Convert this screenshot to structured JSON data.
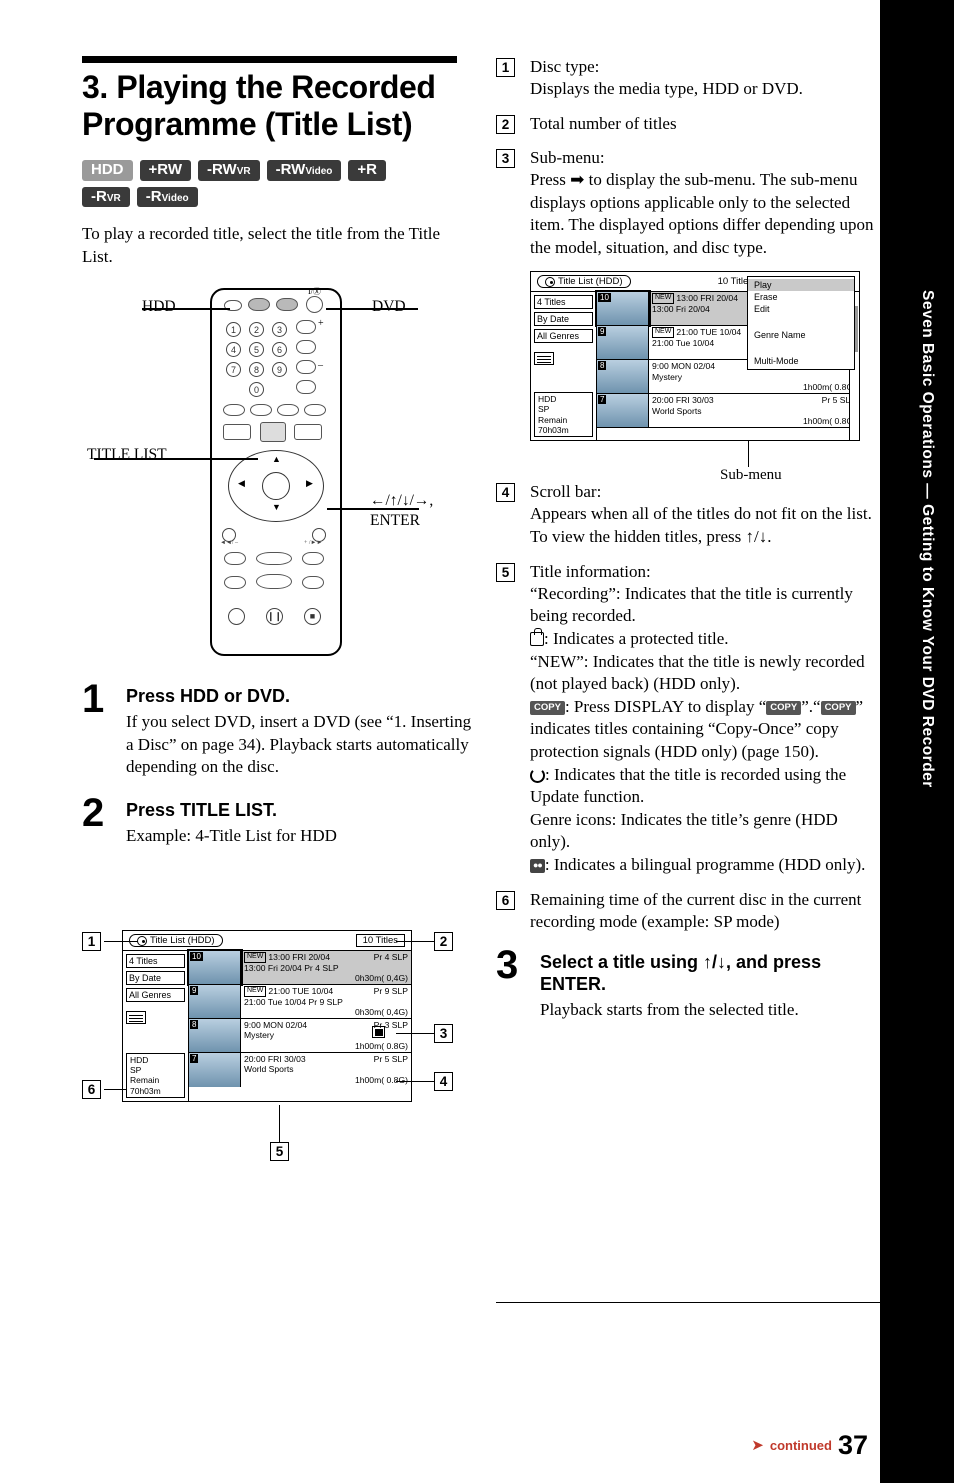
{
  "page": {
    "number": "37",
    "continued": "continued",
    "side_tab": "Seven Basic Operations — Getting to Know Your DVD Recorder"
  },
  "heading": "3. Playing the Recorded Programme (Title List)",
  "badges": [
    {
      "label": "HDD",
      "sub": "",
      "style": "gray"
    },
    {
      "label": "+RW",
      "sub": "",
      "style": "dark"
    },
    {
      "label": "-RW",
      "sub": "VR",
      "style": "dark"
    },
    {
      "label": "-RW",
      "sub": "Video",
      "style": "dark"
    },
    {
      "label": "+R",
      "sub": "",
      "style": "dark"
    },
    {
      "label": "-R",
      "sub": "VR",
      "style": "dark"
    },
    {
      "label": "-R",
      "sub": "Video",
      "style": "dark"
    }
  ],
  "intro": "To play a recorded title, select the title from the Title List.",
  "remote": {
    "label_hdd": "HDD",
    "label_dvd": "DVD",
    "label_title_list": "TITLE LIST",
    "label_enter": "ENTER",
    "label_arrows": "←/↑/↓/→,"
  },
  "steps": [
    {
      "num": "1",
      "title": "Press HDD or DVD.",
      "body": "If you select DVD, insert a DVD (see “1. Inserting a Disc” on page 34). Playback starts automatically depending on the disc."
    },
    {
      "num": "2",
      "title": "Press TITLE LIST.",
      "body": "Example: 4-Title List for HDD"
    },
    {
      "num": "3",
      "title": "Select a title using ↑/↓, and press ENTER.",
      "body": "Playback starts from the selected title."
    }
  ],
  "screen": {
    "tab_label": "Title List (HDD)",
    "titles_count": "10 Titles",
    "left_panel": [
      "4 Titles",
      "By Date",
      "All Genres"
    ],
    "remain": [
      "HDD",
      "SP",
      "Remain",
      "70h03m"
    ],
    "rows": [
      {
        "num": "10",
        "new": "NEW",
        "line1": "13:00 FRI 20/04",
        "line2": "13:00  Fri 20/04",
        "mode": "Pr 4 SLP",
        "mode2": "Pr 4 SLP",
        "size": "0h30m( 0,4G)",
        "selected": true
      },
      {
        "num": "9",
        "new": "NEW",
        "line1": "21:00 TUE 10/04",
        "line2": "21:00  Tue 10/04",
        "mode": "Pr 9 SLP",
        "mode2": "Pr 9 SLP",
        "size": "0h30m( 0,4G)",
        "selected": false
      },
      {
        "num": "8",
        "new": "",
        "line1": "9:00 MON 02/04",
        "line2": "Mystery",
        "mode": "Pr 3 SLP",
        "mode2": "",
        "size": "1h00m( 0.8G)",
        "selected": false
      },
      {
        "num": "7",
        "new": "",
        "line1": "20:00 FRI 30/03",
        "line2": "World Sports",
        "mode": "Pr 5 SLP",
        "mode2": "",
        "size": "1h00m( 0.8G)",
        "selected": false
      }
    ],
    "submenu_items": [
      "Play",
      "Erase",
      "Edit",
      "Genre Name",
      "Multi-Mode"
    ],
    "submenu_caption": "Sub-menu",
    "callouts": [
      "1",
      "2",
      "3",
      "4",
      "5",
      "6"
    ]
  },
  "right_items": [
    {
      "num": "1",
      "head": "Disc type:",
      "body": "Displays the media type, HDD or DVD."
    },
    {
      "num": "2",
      "head": "Total number of titles",
      "body": ""
    },
    {
      "num": "3",
      "head": "Sub-menu:",
      "body": "Press ➡ to display the sub-menu. The sub-menu displays options applicable only to the selected item. The displayed options differ depending upon the model, situation, and disc type."
    },
    {
      "num": "4",
      "head": "Scroll bar:",
      "body": "Appears when all of the titles do not fit on the list. To view the hidden titles, press ↑/↓."
    },
    {
      "num": "5",
      "head": "Title information:",
      "body": ""
    },
    {
      "num": "6",
      "head": "Remaining time of the current disc in the current recording mode (example: SP mode)",
      "body": ""
    }
  ],
  "title_info": {
    "l1": "“Recording”: Indicates that the title is currently being recorded.",
    "l2": ": Indicates a protected title.",
    "l3": "“NEW”: Indicates that the title is newly recorded (not played back) (HDD only).",
    "l4_a": ": Press DISPLAY to display “",
    "l4_b": "”.“",
    "l4_c": "” indicates titles containing “Copy-Once” copy protection signals (HDD only) (page 150).",
    "l5": ": Indicates that the title is recorded using the Update function.",
    "l6": "Genre icons: Indicates the title’s genre (HDD only).",
    "l7": ": Indicates a bilingual programme (HDD only).",
    "copy_label": "COPY"
  }
}
